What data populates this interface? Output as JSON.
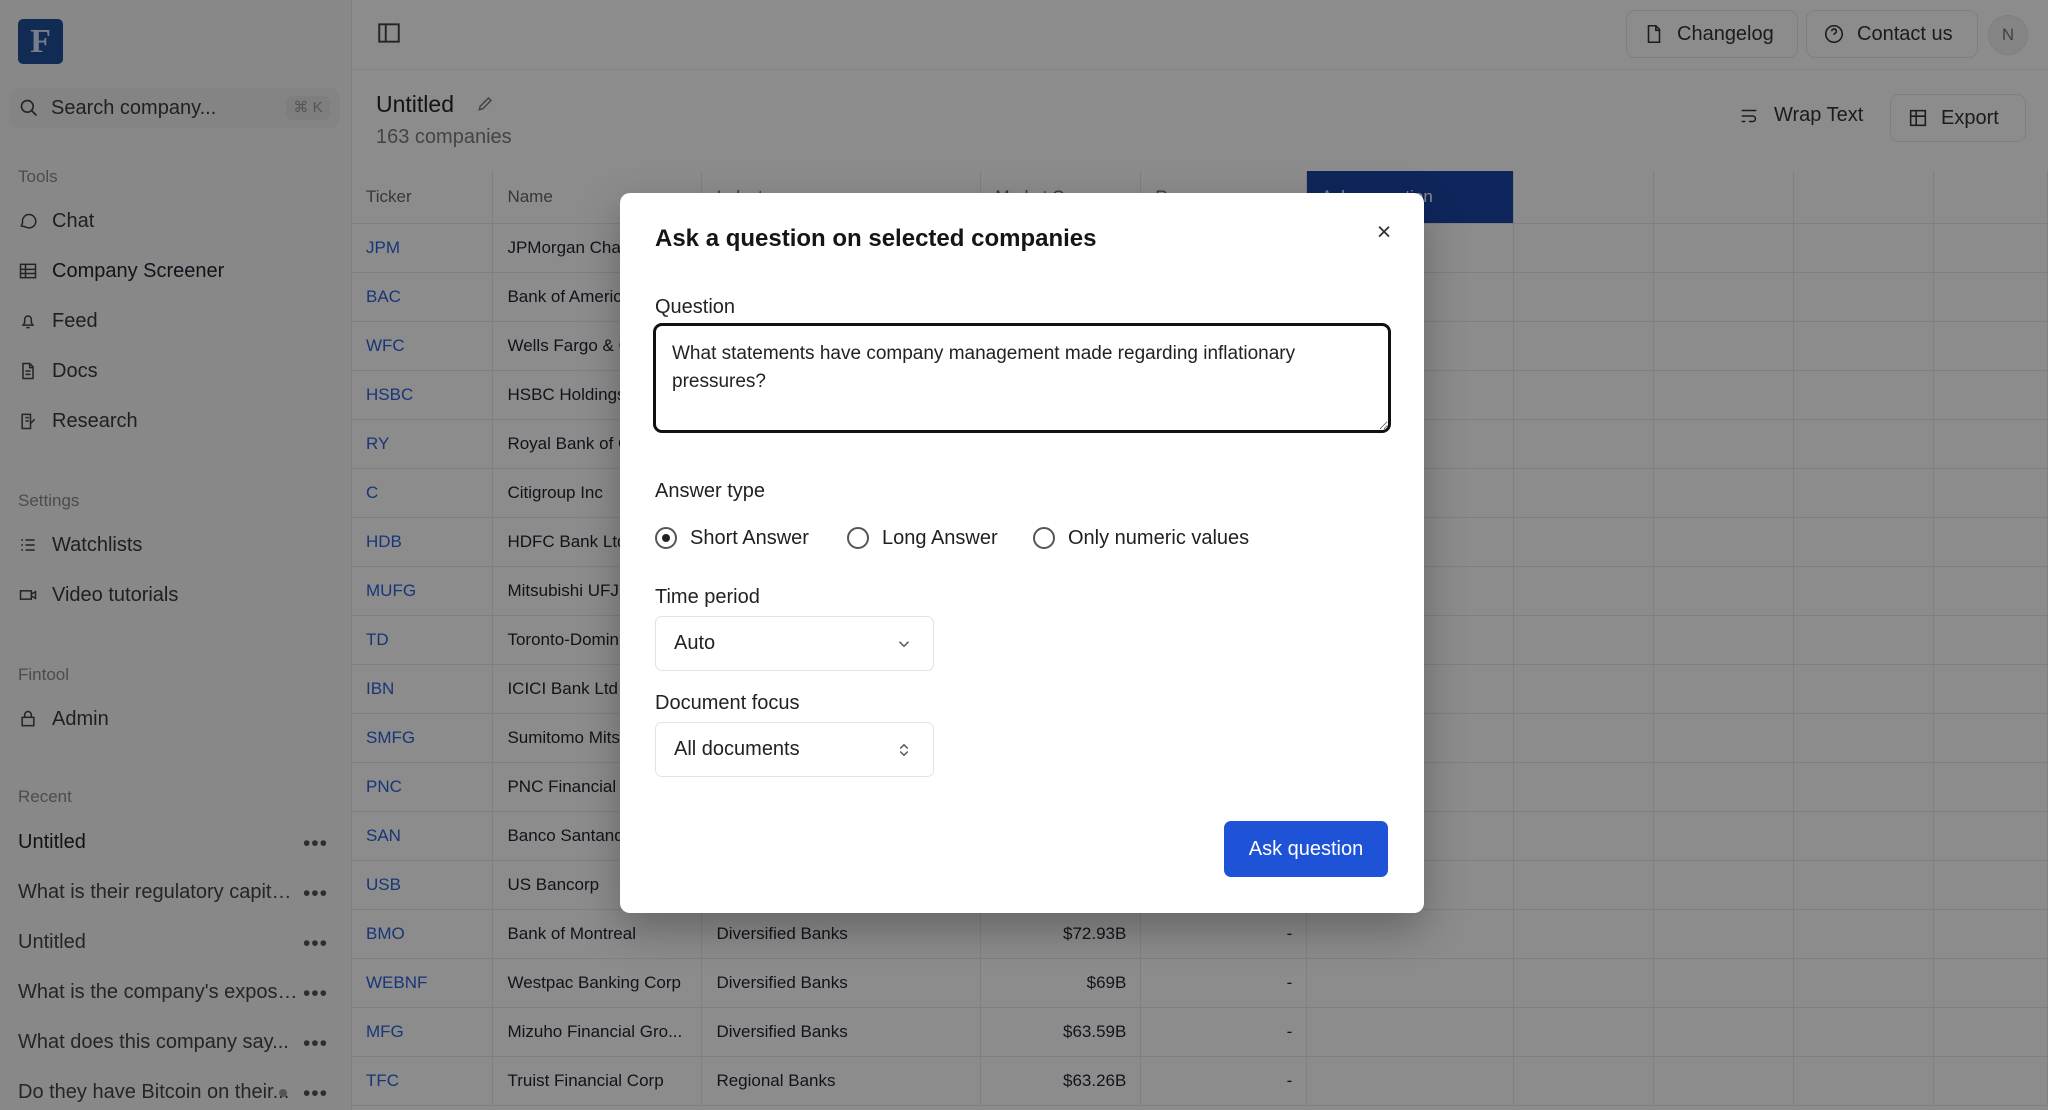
{
  "app": {
    "logo": "F",
    "search_placeholder": "Search company...",
    "search_shortcut": "⌘ K"
  },
  "sidebar": {
    "tools_heading": "Tools",
    "tools": [
      {
        "label": "Chat",
        "icon": "chat-icon"
      },
      {
        "label": "Company Screener",
        "icon": "table-icon"
      },
      {
        "label": "Feed",
        "icon": "bell-icon"
      },
      {
        "label": "Docs",
        "icon": "document-icon"
      },
      {
        "label": "Research",
        "icon": "edit-note-icon"
      }
    ],
    "settings_heading": "Settings",
    "settings": [
      {
        "label": "Watchlists",
        "icon": "list-icon"
      },
      {
        "label": "Video tutorials",
        "icon": "video-icon"
      }
    ],
    "fintool_heading": "Fintool",
    "fintool": [
      {
        "label": "Admin",
        "icon": "lock-icon"
      }
    ],
    "recent_heading": "Recent",
    "recent": [
      {
        "label": "Untitled"
      },
      {
        "label": "What is their regulatory capital..."
      },
      {
        "label": "Untitled"
      },
      {
        "label": "What is the company's exposure..."
      },
      {
        "label": "What does this company say..."
      },
      {
        "label": "Do they have Bitcoin on their..."
      }
    ]
  },
  "topbar": {
    "changelog": "Changelog",
    "contact": "Contact us",
    "avatar": "N"
  },
  "screen": {
    "title": "Untitled",
    "subtitle": "163 companies",
    "wrap": "Wrap Text",
    "export": "Export"
  },
  "table": {
    "headers": [
      "Ticker",
      "Name",
      "Industry",
      "Market Cap",
      "Revenue",
      "Ask a question"
    ],
    "rows": [
      [
        "JPM",
        "JPMorgan Chase & Co",
        "",
        "",
        ""
      ],
      [
        "BAC",
        "Bank of America Corp",
        "",
        "",
        ""
      ],
      [
        "WFC",
        "Wells Fargo & Co",
        "",
        "",
        ""
      ],
      [
        "HSBC",
        "HSBC Holdings",
        "",
        "",
        ""
      ],
      [
        "RY",
        "Royal Bank of Canada",
        "",
        "",
        ""
      ],
      [
        "C",
        "Citigroup Inc",
        "",
        "",
        ""
      ],
      [
        "HDB",
        "HDFC Bank Ltd",
        "",
        "",
        ""
      ],
      [
        "MUFG",
        "Mitsubishi UFJ",
        "",
        "",
        ""
      ],
      [
        "TD",
        "Toronto-Dominion",
        "",
        "",
        ""
      ],
      [
        "IBN",
        "ICICI Bank Ltd",
        "",
        "",
        ""
      ],
      [
        "SMFG",
        "Sumitomo Mitsui",
        "",
        "",
        ""
      ],
      [
        "PNC",
        "PNC Financial",
        "",
        "",
        ""
      ],
      [
        "SAN",
        "Banco Santander",
        "",
        "",
        ""
      ],
      [
        "USB",
        "US Bancorp",
        "",
        "",
        ""
      ],
      [
        "BMO",
        "Bank of Montreal",
        "Diversified Banks",
        "$72.93B",
        "-"
      ],
      [
        "WEBNF",
        "Westpac Banking Corp",
        "Diversified Banks",
        "$69B",
        "-"
      ],
      [
        "MFG",
        "Mizuho Financial Gro...",
        "Diversified Banks",
        "$63.59B",
        "-"
      ],
      [
        "TFC",
        "Truist Financial Corp",
        "Regional Banks",
        "$63.26B",
        "-"
      ]
    ]
  },
  "modal": {
    "title": "Ask a question on selected companies",
    "question_label": "Question",
    "question_value": "What statements have company management made regarding inflationary pressures?",
    "answer_type_label": "Answer type",
    "answer_types": [
      "Short Answer",
      "Long Answer",
      "Only numeric values"
    ],
    "time_label": "Time period",
    "time_value": "Auto",
    "document_label": "Document focus",
    "document_value": "All documents",
    "ask_button": "Ask question"
  }
}
